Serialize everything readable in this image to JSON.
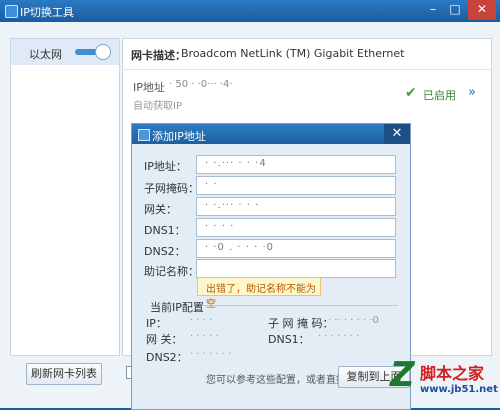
{
  "window": {
    "title": "IP切换工具",
    "min_icon": "minimize-icon",
    "max_icon": "maximize-icon",
    "close_icon": "close-icon"
  },
  "sidebar": {
    "items": [
      {
        "label": "以太网",
        "toggle_on": true
      }
    ],
    "refresh_label": "刷新网卡列表"
  },
  "adapter": {
    "desc_label": "网卡描述：",
    "desc_value": "Broadcom NetLink (TM) Gigabit Ethernet",
    "ip_label": "IP地址",
    "ip_value": "· 50 · ·0··· ·4·",
    "auto_ip": "自动获取IP",
    "status": "已启用"
  },
  "dialog": {
    "title": "添加IP地址",
    "fields": [
      {
        "label": "IP地址：",
        "value": "· ·.··· ·  ·  ·4"
      },
      {
        "label": "子网掩码：",
        "value": "·  ·"
      },
      {
        "label": "网关：",
        "value": "· ·.··· ·  ·  ·"
      },
      {
        "label": "DNS1：",
        "value": "· ·  ·  ·"
      },
      {
        "label": "DNS2：",
        "value": "·  ·0 . · ·  · ·0"
      },
      {
        "label": "助记名称：",
        "value": ""
      }
    ],
    "error_tip": "出错了，助记名称不能为空",
    "current_title": "当前IP配置",
    "current": {
      "ip_label": "IP：",
      "ip_value": "·  ·  · ·",
      "mask_label": "子 网 掩 码：",
      "mask_value": "· ·· ·  · · · ·0",
      "gw_label": "网    关：",
      "gw_value": "· ·  · · ·",
      "dns1_label": "DNS1：",
      "dns1_value": "· ·  · · · · ·",
      "dns2_label": "DNS2：",
      "dns2_value": "· · · · · · ·"
    },
    "hint": "您可以参考这些配置，或者直接",
    "copy_label": "复制到上面"
  },
  "watermark": {
    "brand": "脚本之家",
    "url": "www.jb51.net"
  },
  "colors": {
    "titlebar": "#1a5d9f",
    "accent": "#3e8fd4",
    "error_text": "#b35a00",
    "ok": "#3aa43a"
  }
}
